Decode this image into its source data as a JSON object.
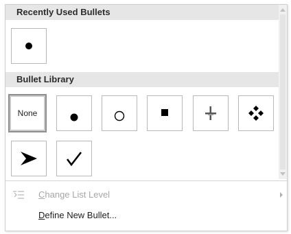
{
  "recent_section": {
    "title": "Recently Used Bullets",
    "items": [
      {
        "icon": "filled-circle-bullet-icon"
      }
    ]
  },
  "library_section": {
    "title": "Bullet Library",
    "items": [
      {
        "label": "None",
        "selected": true
      },
      {
        "icon": "filled-circle-bullet-icon"
      },
      {
        "icon": "hollow-circle-bullet-icon"
      },
      {
        "icon": "filled-square-bullet-icon"
      },
      {
        "icon": "four-point-star-bullet-icon"
      },
      {
        "icon": "four-diamond-bullet-icon"
      },
      {
        "icon": "arrowhead-bullet-icon"
      },
      {
        "icon": "checkmark-bullet-icon"
      }
    ]
  },
  "menu": {
    "change_list_level": {
      "label_first": "C",
      "label_rest": "hange List Level",
      "disabled": true
    },
    "define_new_bullet": {
      "label_first": "D",
      "label_rest": "efine New Bullet..."
    }
  }
}
